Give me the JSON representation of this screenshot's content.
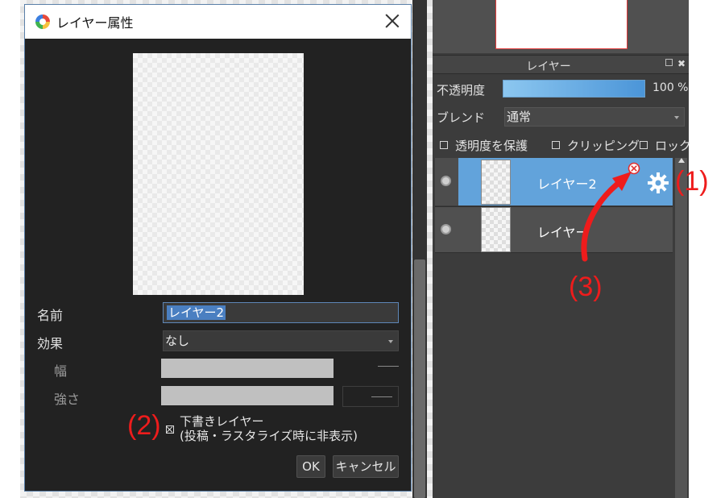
{
  "dialog": {
    "title": "レイヤー属性",
    "name_label": "名前",
    "name_value": "レイヤー2",
    "effect_label": "効果",
    "effect_value": "なし",
    "width_label": "幅",
    "strength_label": "強さ",
    "draft_label_line1": "下書きレイヤー",
    "draft_label_line2": "(投稿・ラスタライズ時に非表示)",
    "ok_label": "OK",
    "cancel_label": "キャンセル"
  },
  "layer_panel": {
    "title": "レイヤー",
    "opacity_label": "不透明度",
    "opacity_value": "100 %",
    "opacity_fraction": 1.0,
    "blend_label": "ブレンド",
    "blend_value": "通常",
    "options": [
      "透明度を保護",
      "クリッピング",
      "ロック"
    ],
    "layers": [
      {
        "name": "レイヤー2",
        "selected": true
      },
      {
        "name": "レイヤー",
        "selected": false
      }
    ]
  },
  "annotations": {
    "one": "(1)",
    "two": "(2)",
    "three": "(3)"
  },
  "colors": {
    "accent_selected_row": "#62a3db",
    "annotation_red": "#ee1c1c",
    "dialog_bg": "#222222"
  }
}
